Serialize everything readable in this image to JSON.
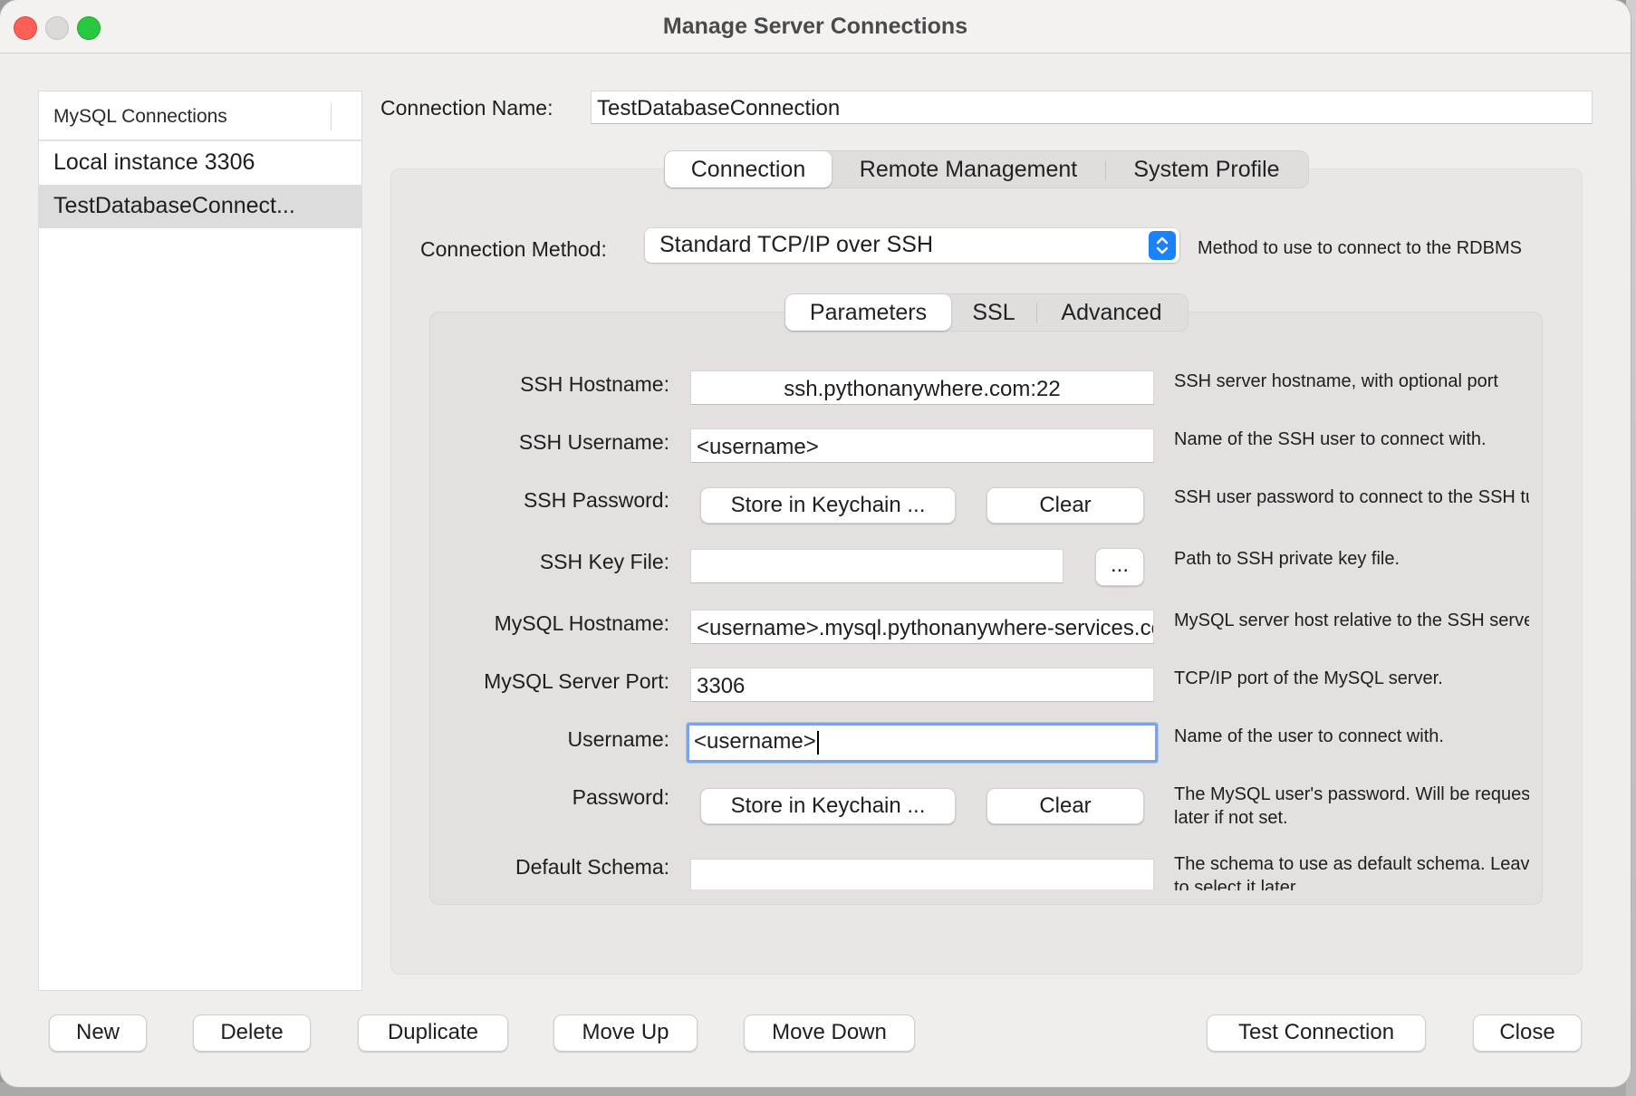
{
  "window": {
    "title": "Manage Server Connections"
  },
  "sidebar": {
    "header": "MySQL Connections",
    "items": [
      {
        "label": "Local instance 3306",
        "selected": false
      },
      {
        "label": "TestDatabaseConnect...",
        "selected": true
      }
    ]
  },
  "connection_name": {
    "label": "Connection Name:",
    "value": "TestDatabaseConnection"
  },
  "tabs": [
    {
      "label": "Connection",
      "active": true
    },
    {
      "label": "Remote Management",
      "active": false
    },
    {
      "label": "System Profile",
      "active": false
    }
  ],
  "connection_method": {
    "label": "Connection Method:",
    "value": "Standard TCP/IP over SSH",
    "help": "Method to use to connect to the RDBMS"
  },
  "subtabs": [
    {
      "label": "Parameters",
      "active": true
    },
    {
      "label": "SSL",
      "active": false
    },
    {
      "label": "Advanced",
      "active": false
    }
  ],
  "params": {
    "ssh_hostname": {
      "label": "SSH Hostname:",
      "value": "ssh.pythonanywhere.com:22",
      "help": "SSH server hostname, with  optional port"
    },
    "ssh_username": {
      "label": "SSH Username:",
      "value": "<username>",
      "help": "Name of the SSH user to connect with."
    },
    "ssh_password": {
      "label": "SSH Password:",
      "store_label": "Store in Keychain ...",
      "clear_label": "Clear",
      "help": "SSH user password to connect to the SSH tunnel."
    },
    "ssh_key_file": {
      "label": "SSH Key File:",
      "value": "",
      "browse_label": "...",
      "help": "Path to SSH private key file."
    },
    "mysql_hostname": {
      "label": "MySQL Hostname:",
      "value": "<username>.mysql.pythonanywhere-services.com",
      "help": "MySQL server host relative to the SSH server."
    },
    "mysql_port": {
      "label": "MySQL Server Port:",
      "value": "3306",
      "help": "TCP/IP port of the MySQL server."
    },
    "username": {
      "label": "Username:",
      "value": "<username>",
      "help": "Name of the user to connect with."
    },
    "password": {
      "label": "Password:",
      "store_label": "Store in Keychain ...",
      "clear_label": "Clear",
      "help_line1": "The MySQL user's password. Will be requested",
      "help_line2": "later if not set."
    },
    "default_schema": {
      "label": "Default Schema:",
      "value": "",
      "help_line1": "The schema to use as default schema. Leave blank",
      "help_line2": "to select it later."
    }
  },
  "footer": {
    "new": "New",
    "delete": "Delete",
    "duplicate": "Duplicate",
    "move_up": "Move Up",
    "move_down": "Move Down",
    "test_connection": "Test Connection",
    "close": "Close"
  },
  "colors": {
    "accent": "#1a82fb",
    "focus_ring": "#7ba3e8",
    "selected_row": "#dcdcdc"
  }
}
